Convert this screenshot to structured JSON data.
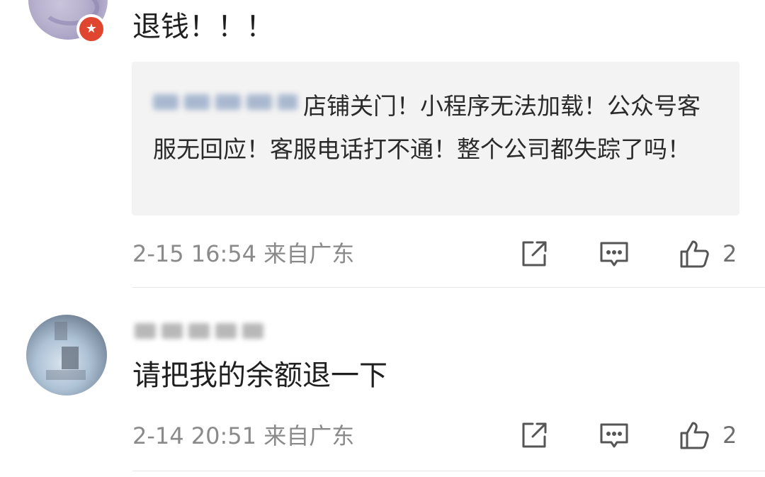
{
  "comments": [
    {
      "text": "退钱！！！",
      "reply": {
        "text": "店铺关门！小程序无法加载！公众号客服无回应！客服电话打不通！整个公司都失踪了吗！"
      },
      "time": "2-15 16:54",
      "location": "来自广东",
      "likes": "2"
    },
    {
      "text": "请把我的余额退一下",
      "time": "2-14 20:51",
      "location": "来自广东",
      "likes": "2"
    }
  ],
  "icons": {
    "share": "share-icon",
    "reply": "comment-icon",
    "like": "thumbs-up-icon"
  },
  "colors": {
    "badge": "#e0452f",
    "meta_text": "#8a8a8a",
    "reply_bg": "#f3f3f3"
  }
}
